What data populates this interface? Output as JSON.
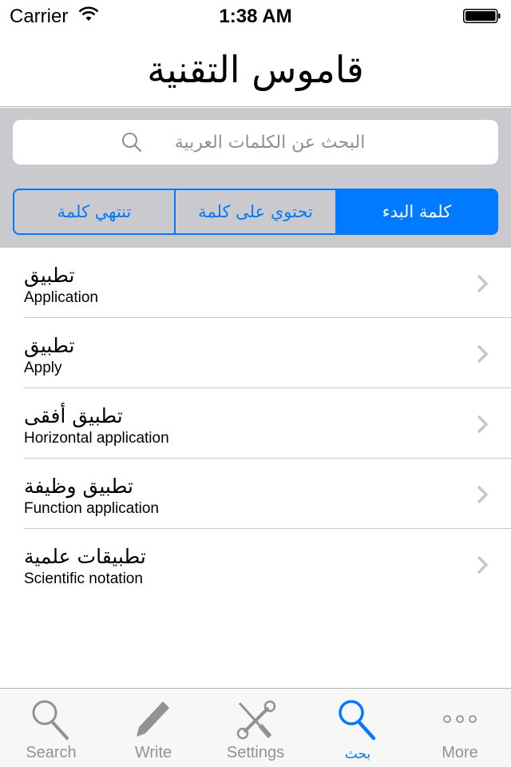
{
  "status_bar": {
    "carrier": "Carrier",
    "time": "1:38 AM"
  },
  "nav": {
    "title": "قاموس التقنية"
  },
  "search": {
    "placeholder": "البحث عن الكلمات العربية",
    "value": ""
  },
  "segments": [
    {
      "label": "كلمة البدء",
      "selected": true
    },
    {
      "label": "تحتوي على كلمة",
      "selected": false
    },
    {
      "label": "تنتهي كلمة",
      "selected": false
    }
  ],
  "results": [
    {
      "arabic": "تطبيق",
      "english": "Application"
    },
    {
      "arabic": "تطبيق",
      "english": "Apply"
    },
    {
      "arabic": "تطبيق أفقى",
      "english": "Horizontal application"
    },
    {
      "arabic": "تطبيق وظيفة",
      "english": "Function application"
    },
    {
      "arabic": "تطبيقات علمية",
      "english": "Scientific notation"
    }
  ],
  "tabs": [
    {
      "label": "Search",
      "icon": "search-icon",
      "active": false
    },
    {
      "label": "Write",
      "icon": "pencil-icon",
      "active": false
    },
    {
      "label": "Settings",
      "icon": "tools-icon",
      "active": false
    },
    {
      "label": "بحث",
      "icon": "search-icon",
      "active": true
    },
    {
      "label": "More",
      "icon": "more-icon",
      "active": false
    }
  ],
  "colors": {
    "accent": "#007aff",
    "search_background": "#c9c9ce",
    "inactive_tab": "#929292",
    "chevron": "#c7c7cc"
  }
}
